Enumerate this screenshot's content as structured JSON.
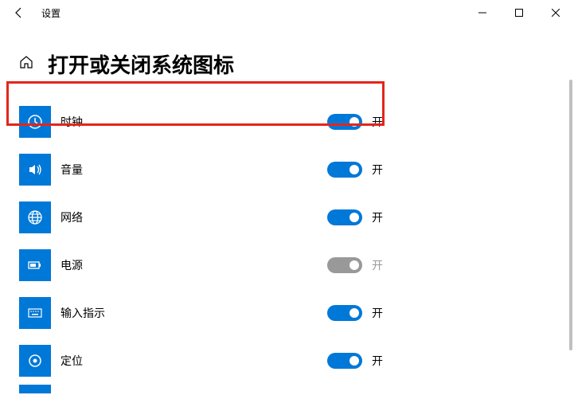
{
  "window": {
    "title": "设置"
  },
  "page": {
    "heading": "打开或关闭系统图标"
  },
  "items": [
    {
      "key": "clock",
      "label": "时钟",
      "state": "开",
      "enabled": true,
      "icon": "clock-icon"
    },
    {
      "key": "volume",
      "label": "音量",
      "state": "开",
      "enabled": true,
      "icon": "volume-icon",
      "highlighted": true
    },
    {
      "key": "network",
      "label": "网络",
      "state": "开",
      "enabled": true,
      "icon": "network-icon"
    },
    {
      "key": "power",
      "label": "电源",
      "state": "开",
      "enabled": false,
      "icon": "power-icon"
    },
    {
      "key": "ime",
      "label": "输入指示",
      "state": "开",
      "enabled": true,
      "icon": "keyboard-icon"
    },
    {
      "key": "location",
      "label": "定位",
      "state": "开",
      "enabled": true,
      "icon": "location-icon"
    }
  ],
  "colors": {
    "primary": "#0078d7",
    "highlight": "#e3261c"
  }
}
